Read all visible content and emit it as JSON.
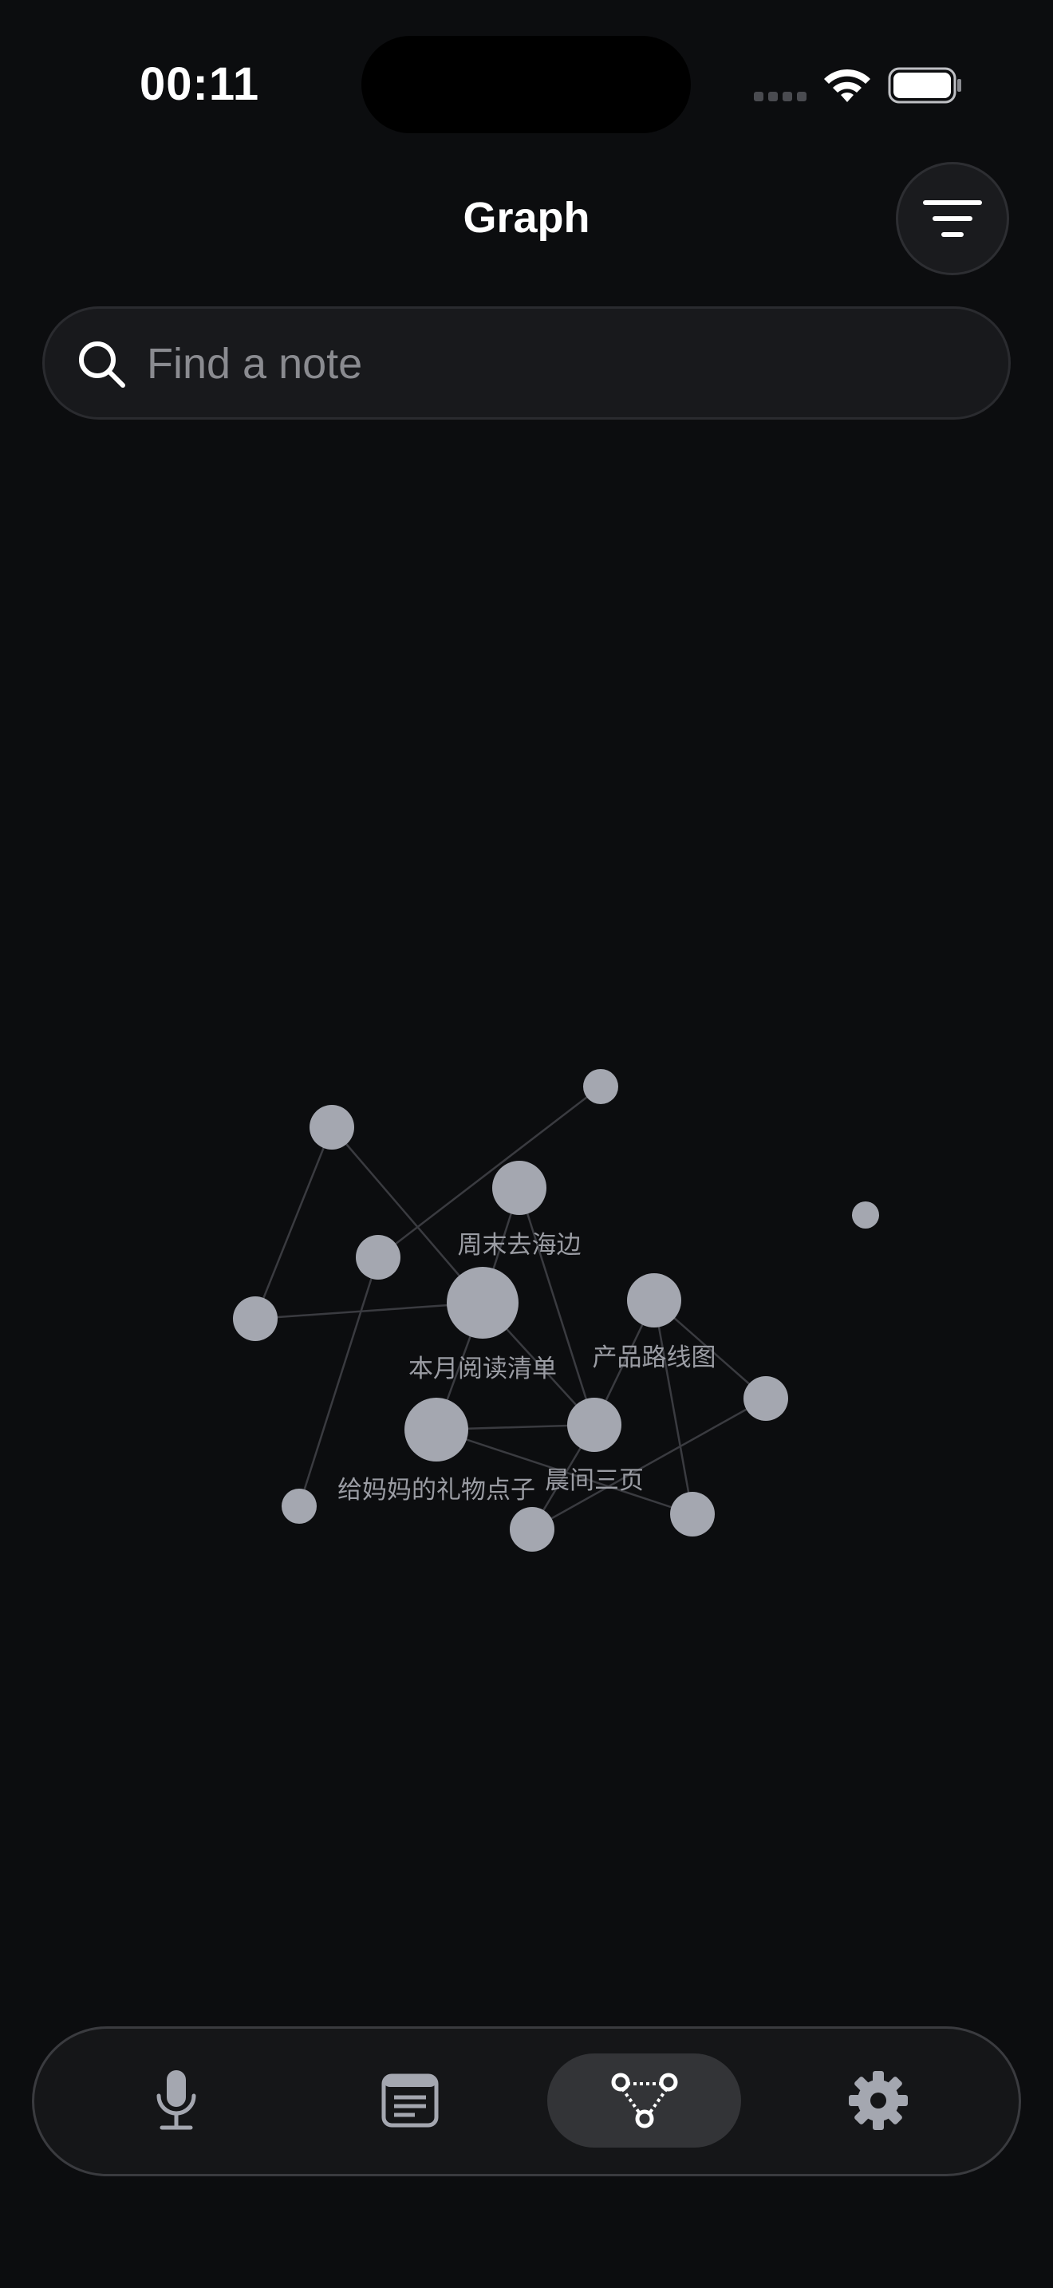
{
  "status_bar": {
    "time": "00:11"
  },
  "header": {
    "title": "Graph",
    "filter_icon": "filter-lines-icon"
  },
  "search": {
    "placeholder": "Find a note",
    "value": "",
    "icon": "search-icon"
  },
  "graph": {
    "labels": {
      "beach": "周末去海边",
      "roadmap": "产品路线图",
      "reading": "本月阅读清单",
      "morning": "晨间三页",
      "gift": "给妈妈的礼物点子"
    }
  },
  "tabs": [
    {
      "name": "record",
      "icon": "microphone-icon",
      "active": false
    },
    {
      "name": "notes",
      "icon": "document-icon",
      "active": false
    },
    {
      "name": "graph",
      "icon": "graph-nodes-icon",
      "active": true
    },
    {
      "name": "settings",
      "icon": "gear-icon",
      "active": false
    }
  ],
  "colors": {
    "background": "#0c0d0f",
    "node": "#a4a7b0",
    "edge": "#3a3b40",
    "label": "#9a9ca3",
    "active_tab": "#333437"
  }
}
